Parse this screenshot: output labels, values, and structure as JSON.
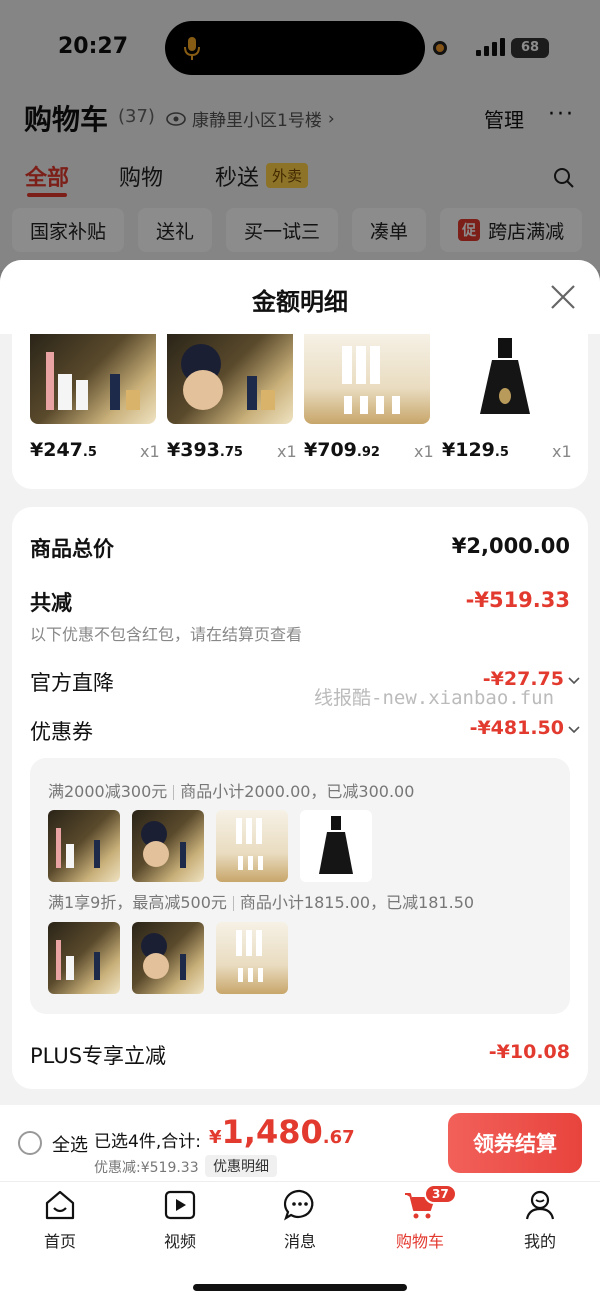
{
  "status_bar": {
    "time": "20:27",
    "battery": "68"
  },
  "header": {
    "title": "购物车",
    "count": "(37)",
    "location": "康静里小区1号楼",
    "manage": "管理",
    "more": "···"
  },
  "tabs": {
    "all": "全部",
    "shopping": "购物",
    "express": "秒送",
    "express_badge": "外卖"
  },
  "chips": [
    "国家补贴",
    "送礼",
    "买一试三",
    "凑单",
    "跨店满减"
  ],
  "chip_promo_icon": "促",
  "sheet": {
    "title": "金额明细",
    "products": [
      {
        "price_int": "¥247",
        "price_dec": ".5",
        "qty": "x1"
      },
      {
        "price_int": "¥393",
        "price_dec": ".75",
        "qty": "x1"
      },
      {
        "price_int": "¥709",
        "price_dec": ".92",
        "qty": "x1"
      },
      {
        "price_int": "¥129",
        "price_dec": ".5",
        "qty": "x1"
      }
    ],
    "total_label": "商品总价",
    "total_value": "¥2,000.00",
    "reduce_label": "共减",
    "reduce_value": "-¥519.33",
    "reduce_note": "以下优惠不包含红包，请在结算页查看",
    "official_label": "官方直降",
    "official_value": "-¥27.75",
    "coupon_label": "优惠券",
    "coupon_value": "-¥481.50",
    "watermark": "线报酷-new.xianbao.fun",
    "coupon_rule1_a": "满2000减300元",
    "coupon_rule1_b": "商品小计2000.00，已减300.00",
    "coupon_rule2_a": "满1享9折，最高减500元",
    "coupon_rule2_b": "商品小计1815.00，已减181.50",
    "plus_label": "PLUS专享立减",
    "plus_value": "-¥10.08"
  },
  "checkout": {
    "select_all": "全选",
    "selected": "已选4件,合计:",
    "yen": "¥",
    "total_int": "1,480",
    "total_dec": ".67",
    "discount": "优惠减:¥519.33",
    "detail": "优惠明细",
    "pay_button": "领券结算"
  },
  "tabbar": {
    "home": "首页",
    "video": "视频",
    "message": "消息",
    "cart": "购物车",
    "cart_badge": "37",
    "mine": "我的"
  },
  "colors": {
    "accent": "#e33a2f",
    "waimai_badge": "#ffd24a"
  }
}
